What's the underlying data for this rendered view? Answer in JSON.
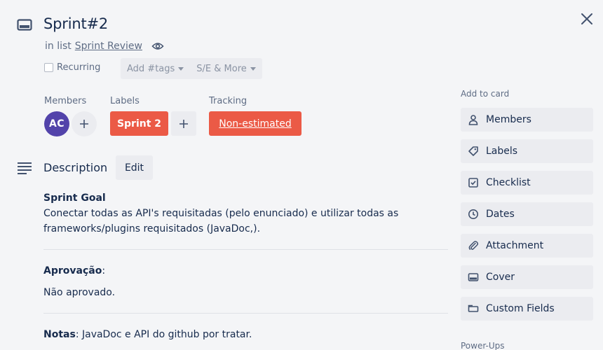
{
  "card": {
    "title": "Sprint#2",
    "in_list_prefix": "in list",
    "list_name": "Sprint Review"
  },
  "options": {
    "recurring_label": "Recurring",
    "tags_label": "Add #tags",
    "se_label": "S/E & More"
  },
  "members": {
    "heading": "Members",
    "avatar_initials": "AC"
  },
  "labels": {
    "heading": "Labels",
    "items": [
      "Sprint 2"
    ]
  },
  "tracking": {
    "heading": "Tracking",
    "value": "Non-estimated"
  },
  "description": {
    "heading": "Description",
    "edit_label": "Edit",
    "goal_title": "Sprint Goal",
    "goal_text": "Conectar todas as API's requisitadas (pelo enunciado) e utilizar todas as frameworks/plugins requisitados (JavaDoc,).",
    "approval_title": "Aprovação",
    "approval_suffix": ":",
    "approval_value": "Não aprovado.",
    "notes_title": "Notas",
    "notes_text": ": JavaDoc e API do github por tratar."
  },
  "sidebar": {
    "heading": "Add to card",
    "buttons": [
      {
        "label": "Members",
        "icon": "person-icon"
      },
      {
        "label": "Labels",
        "icon": "tag-icon"
      },
      {
        "label": "Checklist",
        "icon": "checklist-icon"
      },
      {
        "label": "Dates",
        "icon": "clock-icon"
      },
      {
        "label": "Attachment",
        "icon": "paperclip-icon"
      },
      {
        "label": "Cover",
        "icon": "cover-icon"
      },
      {
        "label": "Custom Fields",
        "icon": "custom-fields-icon"
      }
    ],
    "powerups_heading": "Power-Ups"
  },
  "colors": {
    "label_red": "#eb5a46",
    "avatar_purple": "#5243aa",
    "background": "#f4f5f7"
  }
}
